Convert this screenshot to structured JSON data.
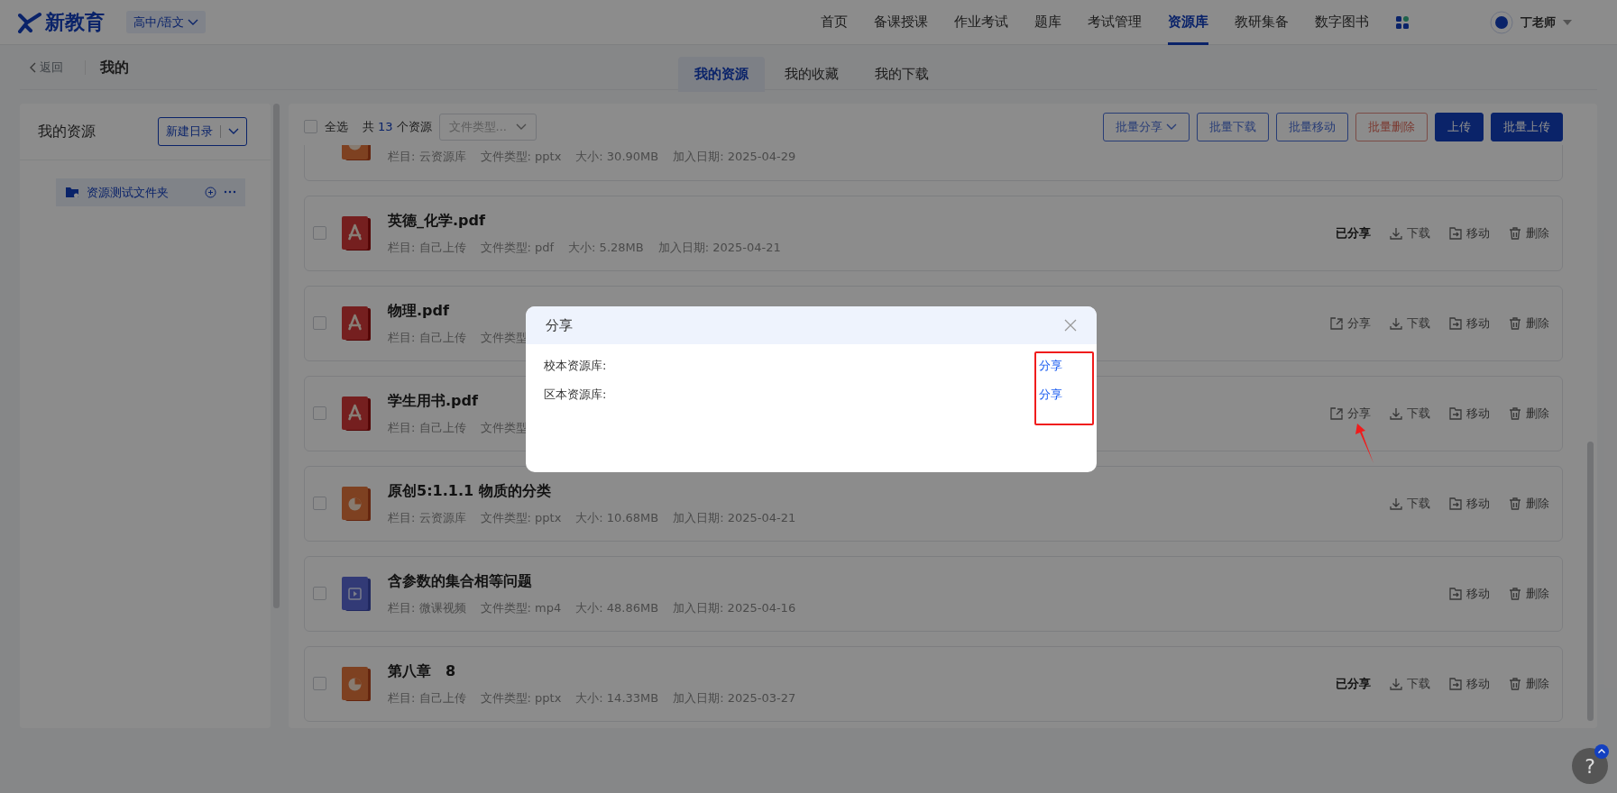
{
  "header": {
    "logo_text": "新教育",
    "subject": "高中/语文",
    "nav": [
      {
        "label": "首页",
        "selected": false
      },
      {
        "label": "备课授课",
        "selected": false
      },
      {
        "label": "作业考试",
        "selected": false
      },
      {
        "label": "题库",
        "selected": false
      },
      {
        "label": "考试管理",
        "selected": false
      },
      {
        "label": "资源库",
        "selected": true
      },
      {
        "label": "教研集备",
        "selected": false
      },
      {
        "label": "数字图书",
        "selected": false
      }
    ],
    "user": "丁老师"
  },
  "subheader": {
    "back": "返回",
    "title": "我的",
    "tabs": [
      {
        "label": "我的资源",
        "selected": true
      },
      {
        "label": "我的收藏",
        "selected": false
      },
      {
        "label": "我的下载",
        "selected": false
      }
    ]
  },
  "sidebar": {
    "title": "我的资源",
    "new_button": "新建日录",
    "folders": [
      {
        "label": "资源测试文件夹",
        "selected": true
      }
    ]
  },
  "toolbar": {
    "select_all": {
      "label": "全选",
      "checked": false
    },
    "count_prefix": "共",
    "count": "13",
    "count_suffix": "个资源",
    "filter_placeholder": "文件类型...",
    "buttons": [
      {
        "label": "批量分享",
        "kind": "outline",
        "dropdown": true
      },
      {
        "label": "批量下载",
        "kind": "outline",
        "dropdown": false
      },
      {
        "label": "批量移动",
        "kind": "outline",
        "dropdown": false
      },
      {
        "label": "批量删除",
        "kind": "danger",
        "dropdown": false
      },
      {
        "label": "上传",
        "kind": "primary",
        "dropdown": false
      },
      {
        "label": "批量上传",
        "kind": "primary",
        "dropdown": false
      }
    ]
  },
  "resources": [
    {
      "kind": "ppt",
      "meta": [
        "栏目: 云资源库",
        "文件类型: pptx",
        "大小: 30.90MB",
        "加入日期: 2025-04-29"
      ]
    },
    {
      "kind": "pdf",
      "checked": false,
      "title": "英德_化学.pdf",
      "meta": [
        "栏目: 自己上传",
        "文件类型: pdf",
        "大小: 5.28MB",
        "加入日期: 2025-04-21"
      ],
      "actions": [
        {
          "kind": "shared",
          "label": "已分享"
        },
        {
          "kind": "download",
          "label": "下载"
        },
        {
          "kind": "move",
          "label": "移动"
        },
        {
          "kind": "delete",
          "label": "删除"
        }
      ]
    },
    {
      "kind": "pdf",
      "checked": false,
      "title": "物理.pdf",
      "meta": [
        "栏目: 自己上传",
        "文件类型"
      ],
      "actions": [
        {
          "kind": "share",
          "label": "分享"
        },
        {
          "kind": "download",
          "label": "下载"
        },
        {
          "kind": "move",
          "label": "移动"
        },
        {
          "kind": "delete",
          "label": "删除"
        }
      ]
    },
    {
      "kind": "pdf",
      "checked": false,
      "title": "学生用书.pdf",
      "meta": [
        "栏目: 自己上传",
        "文件类型"
      ],
      "actions": [
        {
          "kind": "share",
          "label": "分享"
        },
        {
          "kind": "download",
          "label": "下载"
        },
        {
          "kind": "move",
          "label": "移动"
        },
        {
          "kind": "delete",
          "label": "删除"
        }
      ]
    },
    {
      "kind": "ppt",
      "checked": false,
      "title": "原创5:1.1.1 物质的分类",
      "meta": [
        "栏目: 云资源库",
        "文件类型: pptx",
        "大小: 10.68MB",
        "加入日期: 2025-04-21"
      ],
      "actions": [
        {
          "kind": "download",
          "label": "下载"
        },
        {
          "kind": "move",
          "label": "移动"
        },
        {
          "kind": "delete",
          "label": "删除"
        }
      ]
    },
    {
      "kind": "video",
      "checked": false,
      "title": "含参数的集合相等问题",
      "meta": [
        "栏目: 微课视频",
        "文件类型: mp4",
        "大小: 48.86MB",
        "加入日期: 2025-04-16"
      ],
      "actions": [
        {
          "kind": "move",
          "label": "移动"
        },
        {
          "kind": "delete",
          "label": "删除"
        }
      ]
    },
    {
      "kind": "ppt",
      "checked": false,
      "title": "第八章　8",
      "meta": [
        "栏目: 自己上传",
        "文件类型: pptx",
        "大小: 14.33MB",
        "加入日期: 2025-03-27"
      ],
      "actions": [
        {
          "kind": "shared",
          "label": "已分享"
        },
        {
          "kind": "download",
          "label": "下载"
        },
        {
          "kind": "move",
          "label": "移动"
        },
        {
          "kind": "delete",
          "label": "删除"
        }
      ]
    }
  ],
  "share_dialog": {
    "title": "分享",
    "rows": [
      {
        "label": "校本资源库:",
        "action": "分享"
      },
      {
        "label": "区本资源库:",
        "action": "分享"
      }
    ]
  },
  "help_button": "?"
}
